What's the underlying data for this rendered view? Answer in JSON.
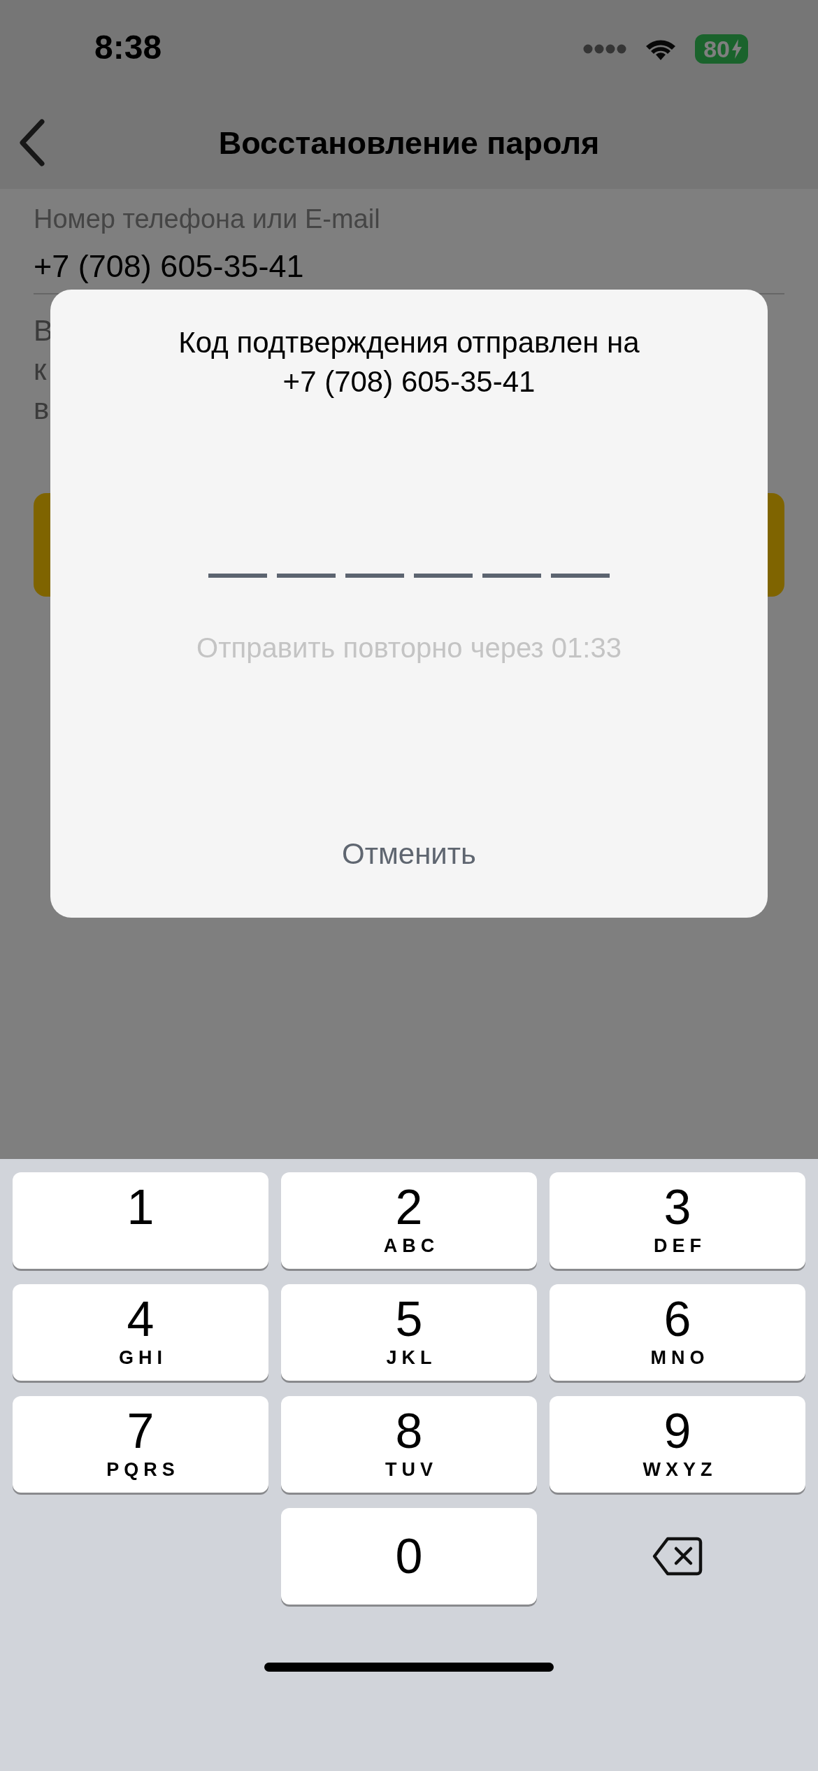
{
  "status_bar": {
    "time": "8:38",
    "battery": "80",
    "charging": true
  },
  "nav": {
    "title": "Восстановление пароля"
  },
  "form": {
    "label": "Номер телефона или E-mail",
    "value": "+7 (708) 605-35-41",
    "hidden_lines": [
      "В",
      "к",
      "в"
    ]
  },
  "dialog": {
    "title": "Код подтверждения отправлен на",
    "phone": "+7 (708) 605-35-41",
    "code_slots": [
      {
        "kind": "empty"
      },
      {
        "kind": "empty"
      },
      {
        "kind": "empty"
      },
      {
        "kind": "empty"
      },
      {
        "kind": "empty"
      },
      {
        "kind": "empty"
      }
    ],
    "resend": "Отправить повторно через 01:33",
    "cancel": "Отменить"
  },
  "keypad": {
    "rows": [
      [
        {
          "digit": "1"
        },
        {
          "digit": "2",
          "letters": "ABC"
        },
        {
          "digit": "3",
          "letters": "DEF"
        }
      ],
      [
        {
          "digit": "4",
          "letters": "GHI"
        },
        {
          "digit": "5",
          "letters": "JKL"
        },
        {
          "digit": "6",
          "letters": "MNO"
        }
      ],
      [
        {
          "digit": "7",
          "letters": "PQRS"
        },
        {
          "digit": "8",
          "letters": "TUV"
        },
        {
          "digit": "9",
          "letters": "WXYZ"
        }
      ]
    ],
    "zero": {
      "digit": "0"
    }
  }
}
